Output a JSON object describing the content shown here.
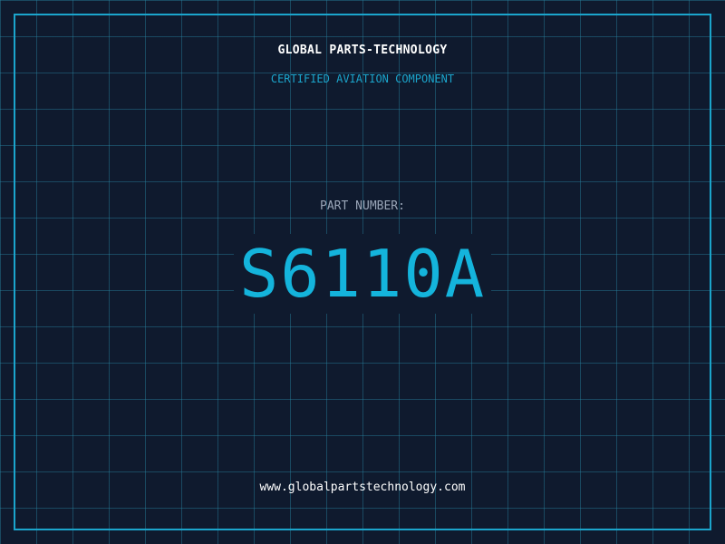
{
  "header": {
    "company": "GLOBAL PARTS-TECHNOLOGY",
    "tagline": "CERTIFIED AVIATION COMPONENT"
  },
  "part": {
    "label": "PART NUMBER:",
    "number": "S6110A"
  },
  "footer": {
    "website": "www.globalpartstechnology.com"
  },
  "colors": {
    "background": "#0f1a2e",
    "grid": "#2882a0",
    "accent": "#1ba5cc",
    "part_number": "#14b4dc",
    "text": "#ffffff",
    "muted": "#9aa6b8"
  }
}
